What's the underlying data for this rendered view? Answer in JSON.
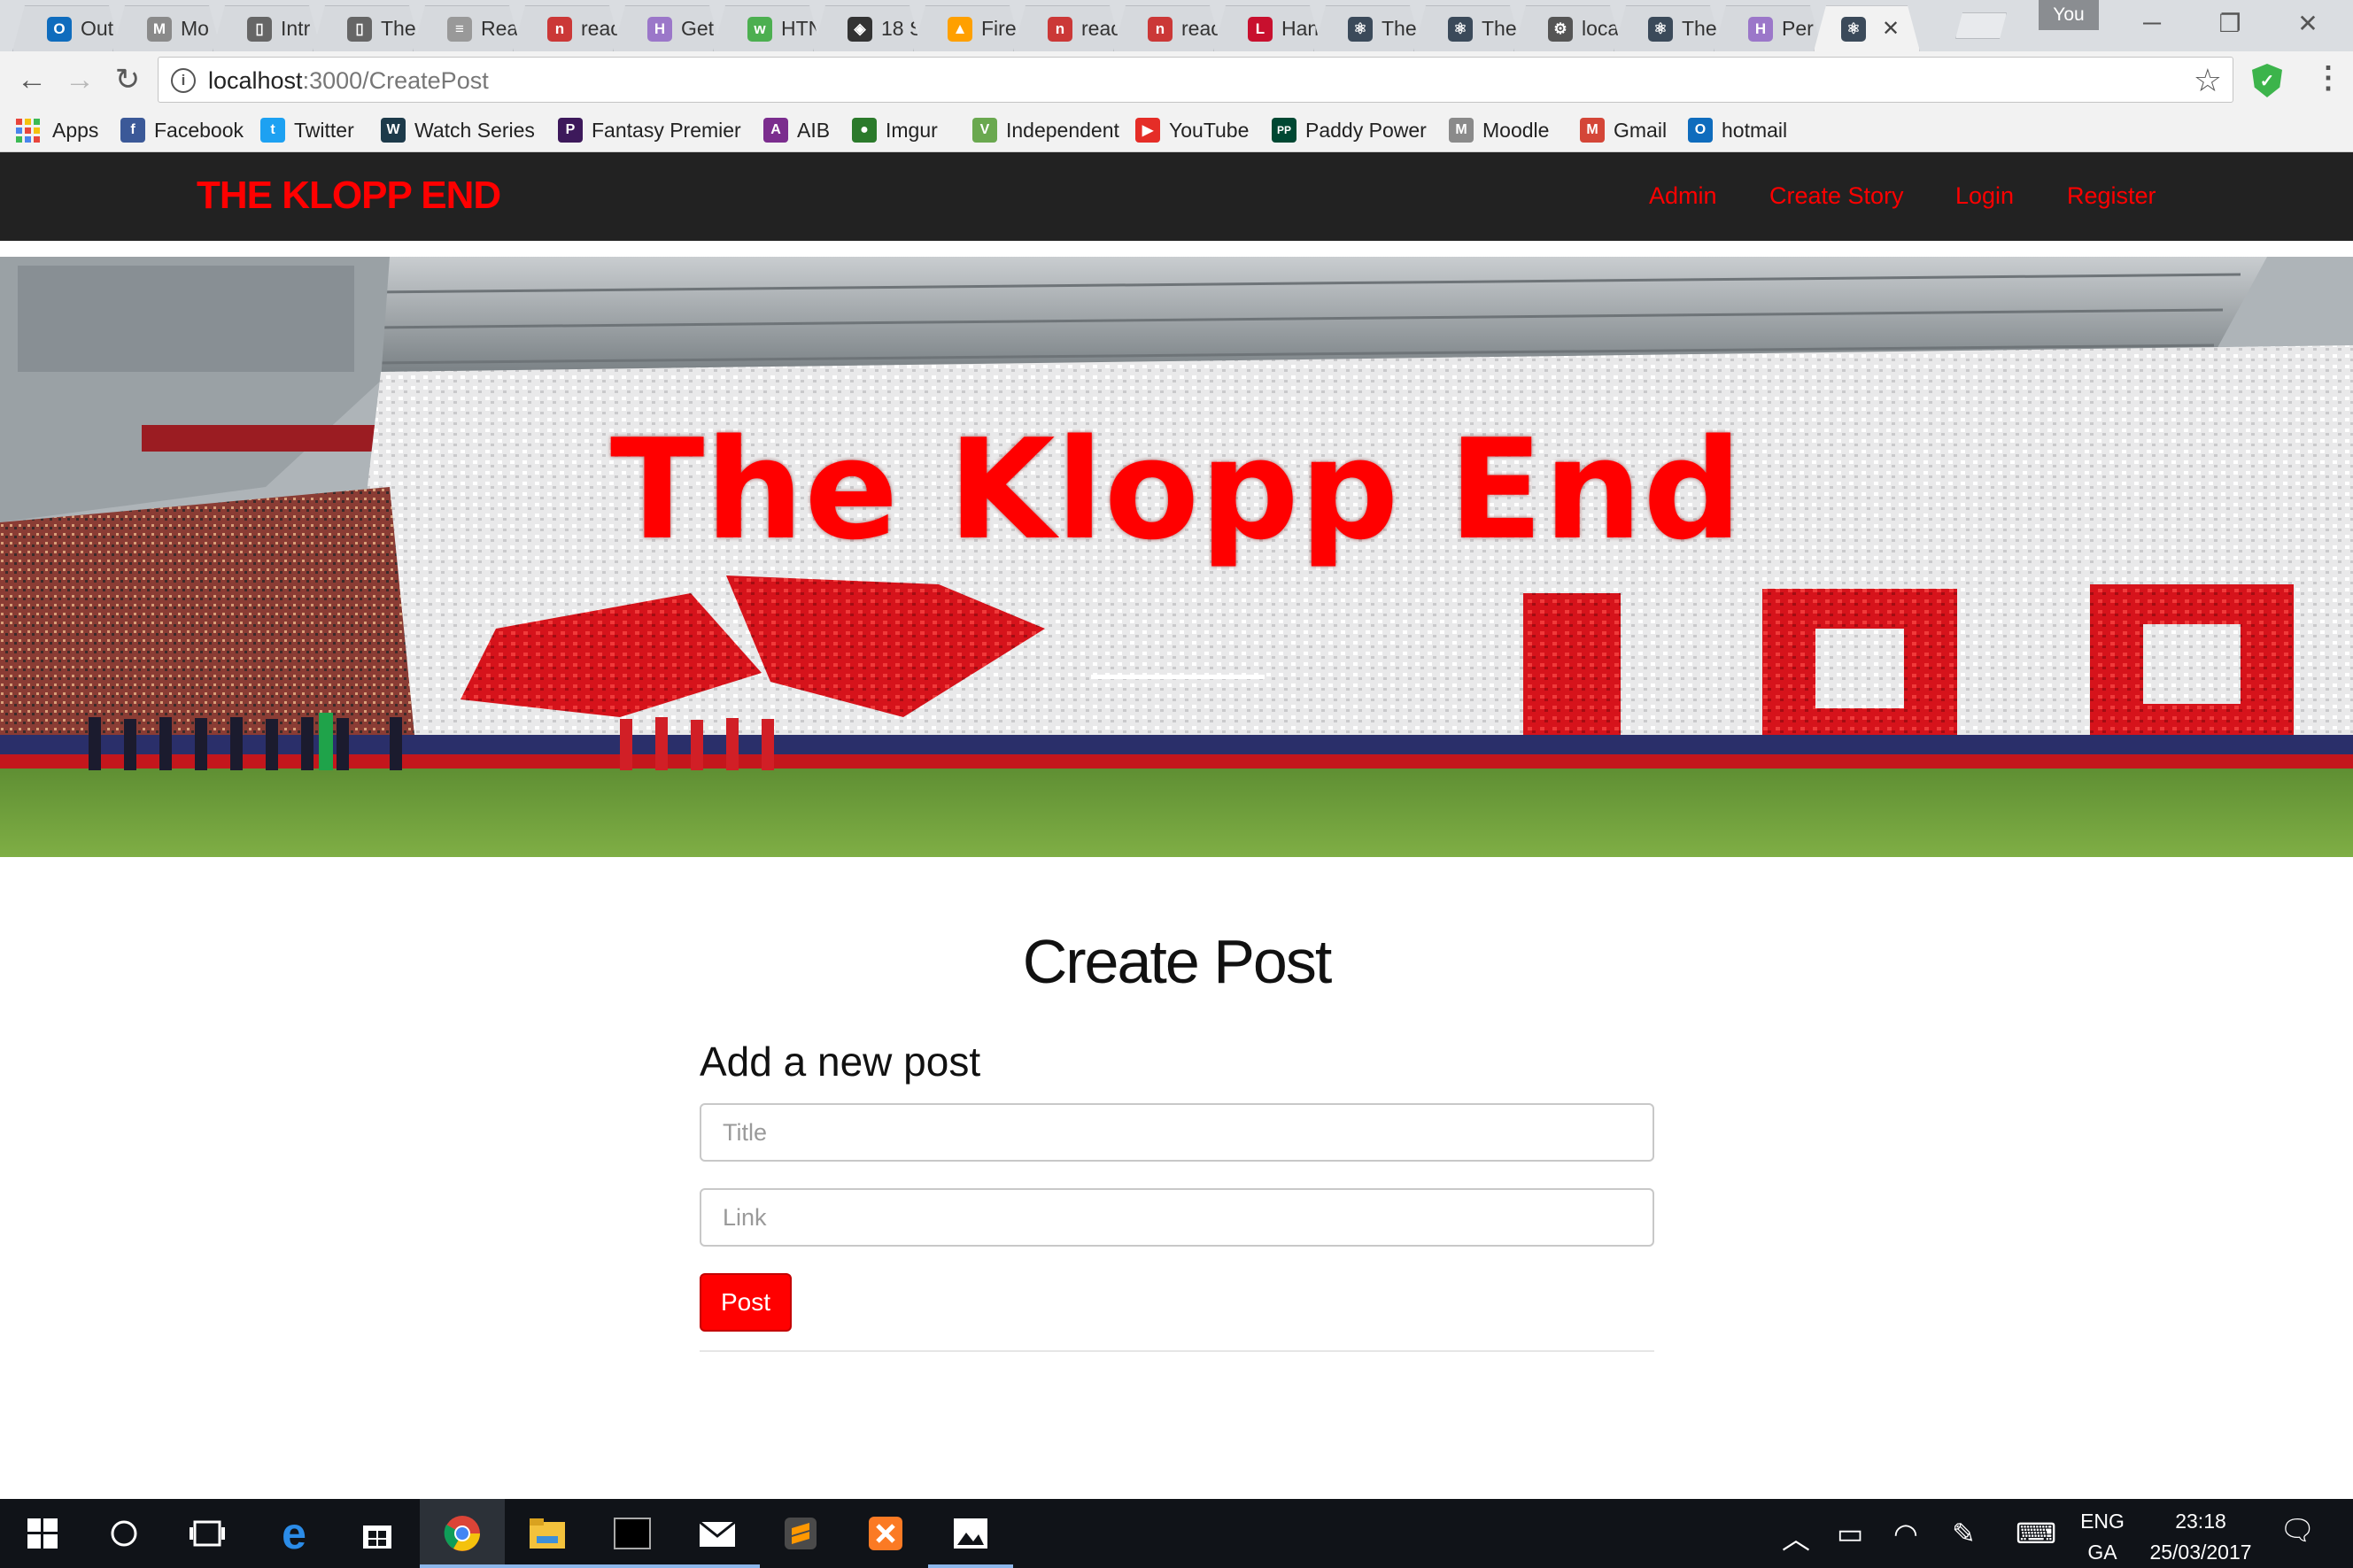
{
  "browser": {
    "tabs": [
      {
        "title": "Out",
        "icon": "outlook-icon",
        "color": "#0f6cbd",
        "glyph": "O"
      },
      {
        "title": "Mo",
        "icon": "moodle-icon",
        "color": "#8a8a8a",
        "glyph": "M"
      },
      {
        "title": "Intr",
        "icon": "book-icon",
        "color": "#666666",
        "glyph": "▯"
      },
      {
        "title": "The",
        "icon": "book-icon",
        "color": "#666666",
        "glyph": "▯"
      },
      {
        "title": "Rea",
        "icon": "doc-icon",
        "color": "#999999",
        "glyph": "≡"
      },
      {
        "title": "reac",
        "icon": "npm-icon",
        "color": "#cb3837",
        "glyph": "n"
      },
      {
        "title": "Get",
        "icon": "heroku-icon",
        "color": "#9b77c9",
        "glyph": "H"
      },
      {
        "title": "HTN",
        "icon": "w3-icon",
        "color": "#4caf50",
        "glyph": "w"
      },
      {
        "title": "18 S",
        "icon": "codepen-icon",
        "color": "#333333",
        "glyph": "◈"
      },
      {
        "title": "Fire",
        "icon": "firebase-icon",
        "color": "#ffa000",
        "glyph": "▲"
      },
      {
        "title": "reac",
        "icon": "npm-icon",
        "color": "#cb3837",
        "glyph": "n"
      },
      {
        "title": "reac",
        "icon": "npm-icon",
        "color": "#cb3837",
        "glyph": "n"
      },
      {
        "title": "Han",
        "icon": "liverpool-icon",
        "color": "#c8102e",
        "glyph": "L"
      },
      {
        "title": "The",
        "icon": "react-icon",
        "color": "#3b4a5a",
        "glyph": "⚛"
      },
      {
        "title": "The",
        "icon": "react-icon",
        "color": "#3b4a5a",
        "glyph": "⚛"
      },
      {
        "title": "loca",
        "icon": "gear-icon",
        "color": "#555555",
        "glyph": "⚙"
      },
      {
        "title": "The",
        "icon": "react-icon",
        "color": "#3b4a5a",
        "glyph": "⚛"
      },
      {
        "title": "Per",
        "icon": "heroku-icon",
        "color": "#9b77c9",
        "glyph": "H"
      },
      {
        "title": "",
        "icon": "react-icon",
        "color": "#3b4a5a",
        "glyph": "⚛",
        "active": true
      }
    ],
    "profile_label": "You",
    "url_host": "localhost",
    "url_path": ":3000/CreatePost",
    "bookmarks": [
      {
        "label": "Apps",
        "icon": "apps-grid-icon",
        "color": "#e8453c"
      },
      {
        "label": "Facebook",
        "icon": "facebook-icon",
        "color": "#3b5998",
        "glyph": "f"
      },
      {
        "label": "Twitter",
        "icon": "twitter-icon",
        "color": "#1da1f2",
        "glyph": "t"
      },
      {
        "label": "Watch Series",
        "icon": "watchseries-icon",
        "color": "#1d3a4a",
        "glyph": "W"
      },
      {
        "label": "Fantasy Premier",
        "icon": "premier-league-icon",
        "color": "#3d195b",
        "glyph": "P"
      },
      {
        "label": "AIB",
        "icon": "aib-icon",
        "color": "#7b2d8e",
        "glyph": "A"
      },
      {
        "label": "Imgur",
        "icon": "imgur-icon",
        "color": "#2b7a2b",
        "glyph": "●"
      },
      {
        "label": "Independent",
        "icon": "independent-icon",
        "color": "#6aa84f",
        "glyph": "V"
      },
      {
        "label": "YouTube",
        "icon": "youtube-icon",
        "color": "#e52d27",
        "glyph": "▶"
      },
      {
        "label": "Paddy Power",
        "icon": "paddypower-icon",
        "color": "#004833",
        "glyph": "PP"
      },
      {
        "label": "Moodle",
        "icon": "moodle-icon",
        "color": "#8a8a8a",
        "glyph": "M"
      },
      {
        "label": "Gmail",
        "icon": "gmail-icon",
        "color": "#d44638",
        "glyph": "M"
      },
      {
        "label": "hotmail",
        "icon": "hotmail-icon",
        "color": "#0f6cbd",
        "glyph": "O"
      }
    ]
  },
  "site": {
    "brand": "THE KLOPP END",
    "nav": [
      "Admin",
      "Create Story",
      "Login",
      "Register"
    ],
    "hero_title": "The Klopp End",
    "page_heading": "Create Post",
    "form_heading": "Add a new post",
    "title_placeholder": "Title",
    "link_placeholder": "Link",
    "post_button": "Post",
    "accent_color": "#ff0000",
    "navbar_color": "#222222"
  },
  "taskbar": {
    "apps": [
      "windows-start-icon",
      "cortana-icon",
      "task-view-icon",
      "edge-icon",
      "store-icon",
      "chrome-icon",
      "file-explorer-icon",
      "terminal-icon",
      "mail-icon",
      "sublime-icon",
      "xampp-icon",
      "photos-icon"
    ],
    "language_top": "ENG",
    "language_bottom": "GA",
    "time": "23:18",
    "date": "25/03/2017"
  }
}
